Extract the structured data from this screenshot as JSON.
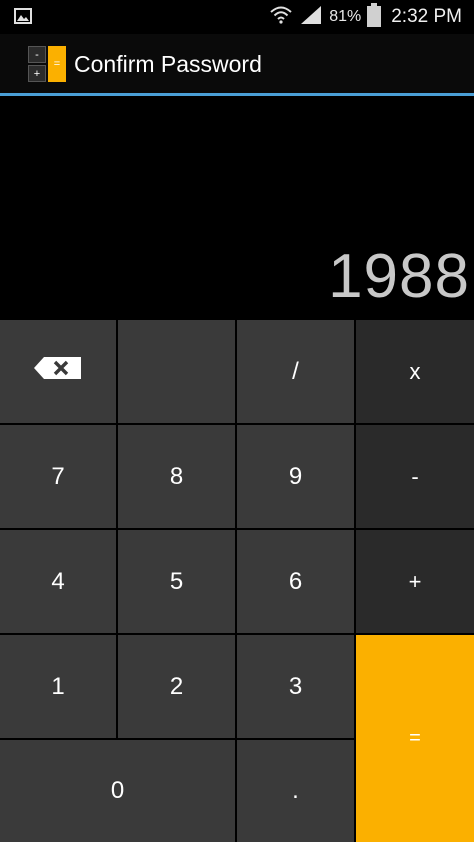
{
  "status_bar": {
    "notification_icon": "image-icon",
    "wifi_icon": "wifi-icon",
    "signal_icon": "signal-bars-icon",
    "battery_percent": "81%",
    "battery_icon": "battery-icon",
    "time": "2:32 PM"
  },
  "action_bar": {
    "icon_minus": "-",
    "icon_plus": "+",
    "icon_equals": "=",
    "title": "Confirm Password",
    "divider_color": "#4a9fd6"
  },
  "display": {
    "value": "1988"
  },
  "keys": {
    "backspace_icon": "backspace-icon",
    "blank": "",
    "divide": "/",
    "multiply": "x",
    "seven": "7",
    "eight": "8",
    "nine": "9",
    "minus": "-",
    "four": "4",
    "five": "5",
    "six": "6",
    "plus": "+",
    "one": "1",
    "two": "2",
    "three": "3",
    "equals": "=",
    "zero": "0",
    "decimal": "."
  },
  "colors": {
    "accent": "#fbb000",
    "key": "#3a3a3a",
    "operator_key": "#2a2a2a",
    "display_text": "#c8c8c8"
  }
}
